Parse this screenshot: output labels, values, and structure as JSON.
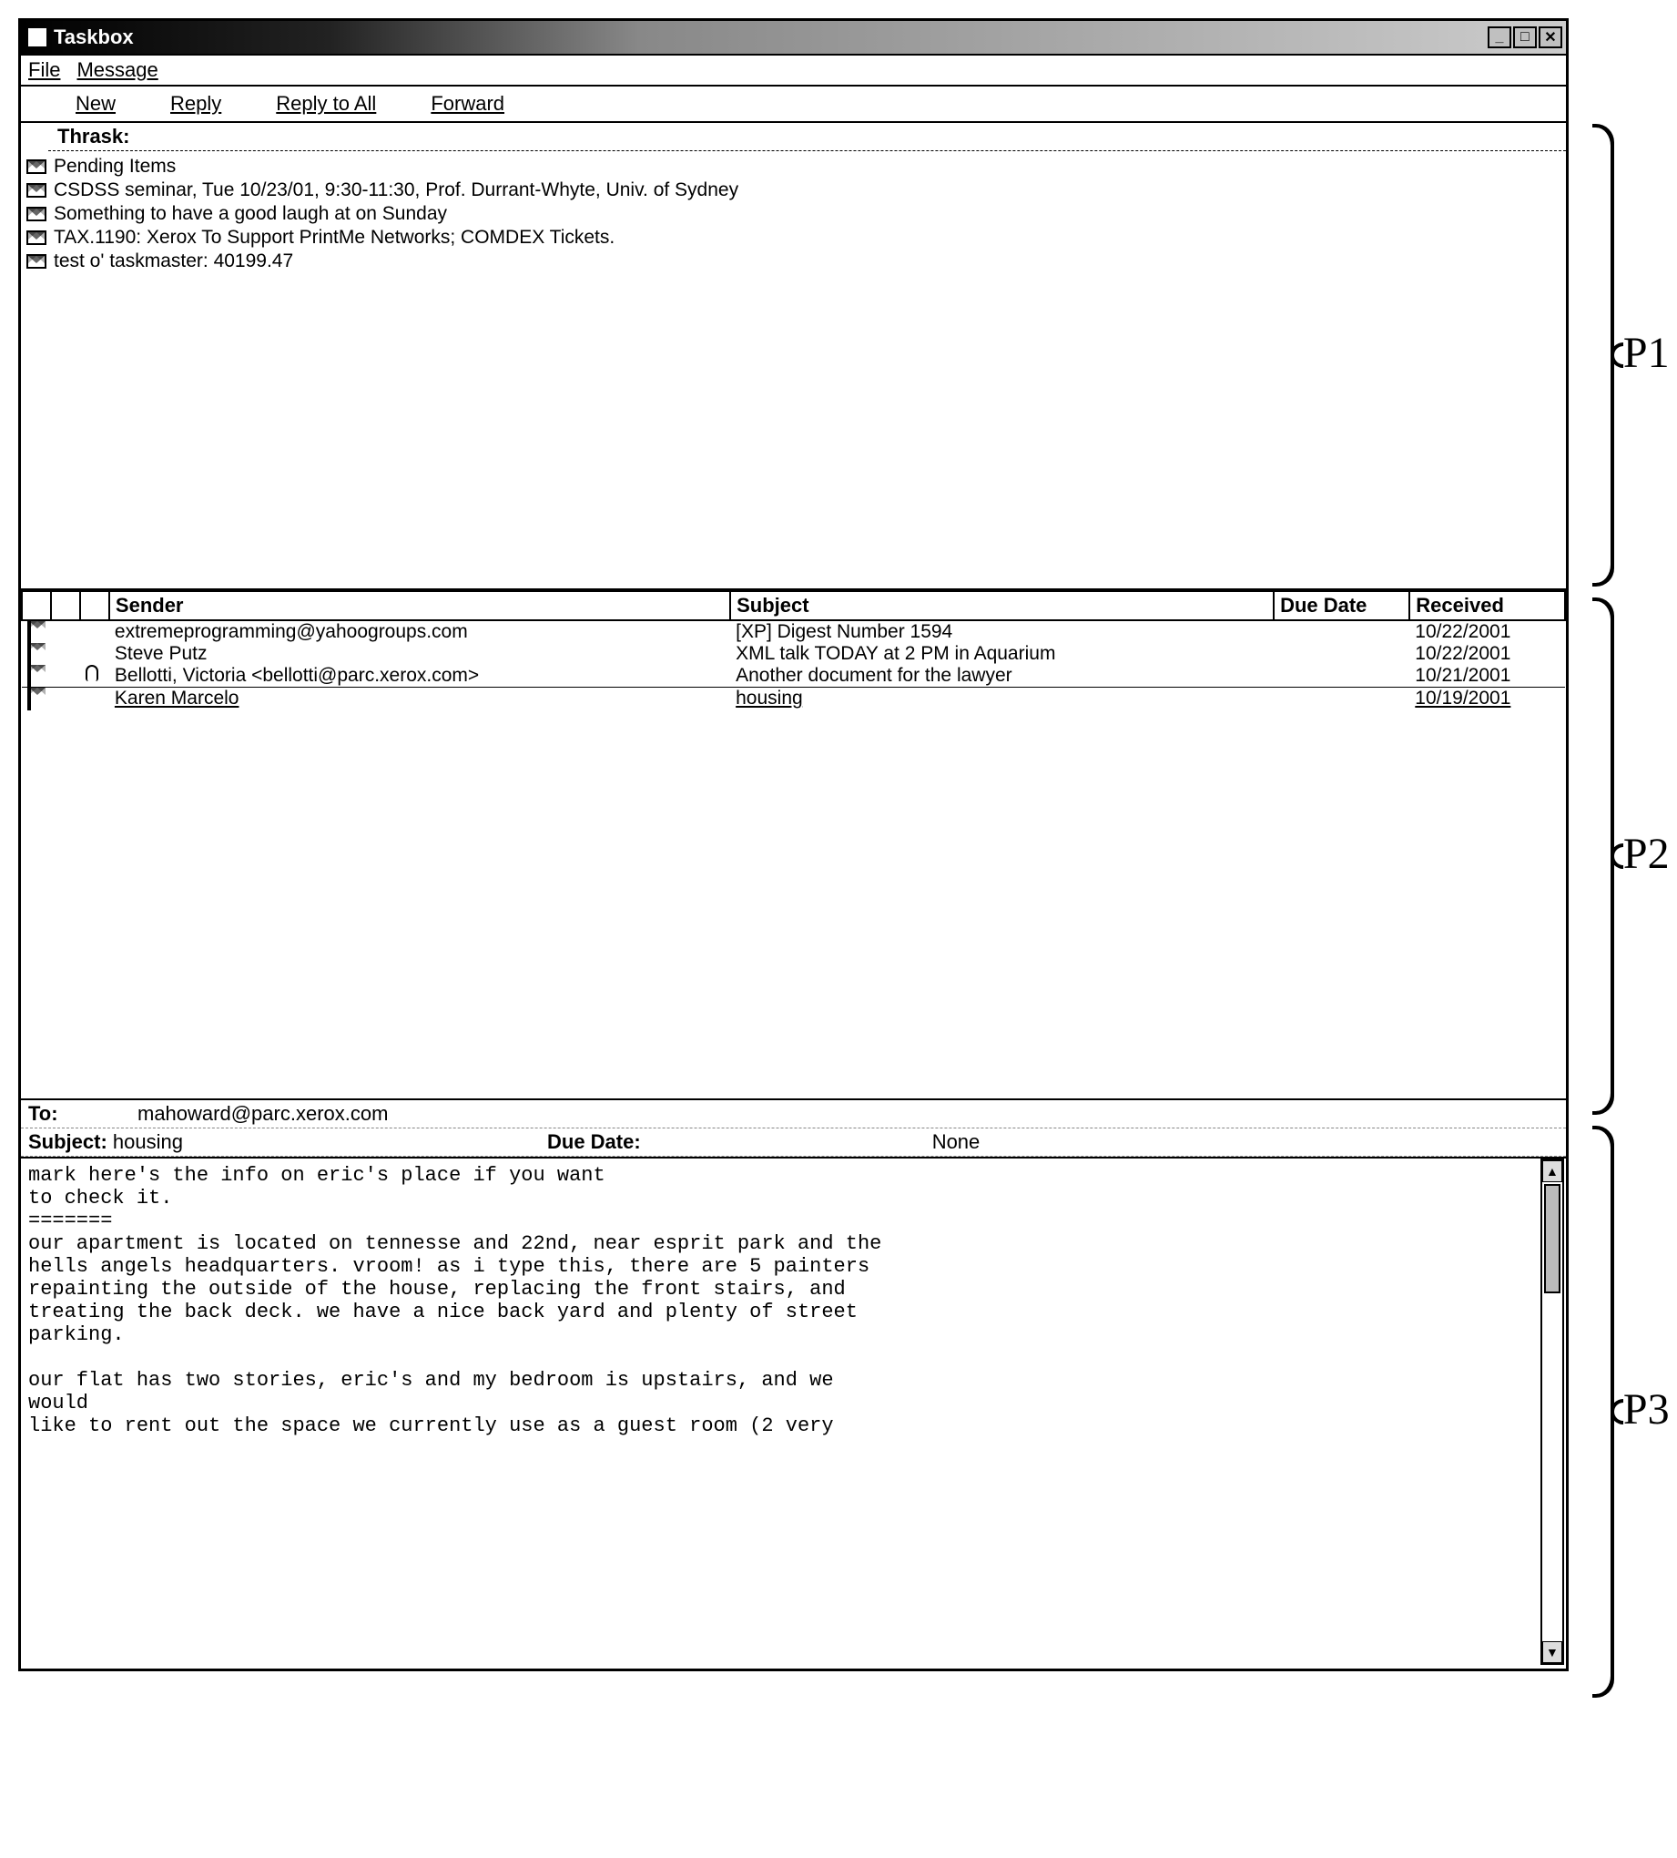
{
  "window": {
    "title": "Taskbox"
  },
  "menubar": {
    "file": "File",
    "message": "Message"
  },
  "toolbar": {
    "new": "New",
    "reply": "Reply",
    "reply_all": "Reply to All",
    "forward": "Forward"
  },
  "p1": {
    "header": "Thrask:",
    "items": [
      "Pending Items",
      "CSDSS seminar, Tue 10/23/01, 9:30-11:30, Prof. Durrant-Whyte, Univ. of Sydney",
      "Something to have a good laugh at on Sunday",
      "TAX.1190: Xerox To Support PrintMe Networks; COMDEX Tickets.",
      "test o' taskmaster: 40199.47"
    ]
  },
  "p2": {
    "columns": {
      "sender": "Sender",
      "subject": "Subject",
      "due": "Due Date",
      "received": "Received"
    },
    "rows": [
      {
        "sender": "extremeprogramming@yahoogroups.com",
        "subject": "[XP] Digest Number 1594",
        "due": "",
        "received": "10/22/2001",
        "attach": false,
        "selected": false
      },
      {
        "sender": "Steve Putz",
        "subject": "XML talk TODAY at 2 PM in Aquarium",
        "due": "",
        "received": "10/22/2001",
        "attach": false,
        "selected": false
      },
      {
        "sender": "Bellotti, Victoria <bellotti@parc.xerox.com>",
        "subject": "Another document for the lawyer",
        "due": "",
        "received": "10/21/2001",
        "attach": true,
        "selected": false
      },
      {
        "sender": "Karen Marcelo",
        "subject": "housing",
        "due": "",
        "received": "10/19/2001",
        "attach": false,
        "selected": true
      }
    ]
  },
  "p3": {
    "to_label": "To:",
    "to_value": "mahoward@parc.xerox.com",
    "subject_label": "Subject:",
    "subject_value": "housing",
    "due_label": "Due Date:",
    "due_value": "None",
    "body": "mark here's the info on eric's place if you want\nto check it.\n=======\nour apartment is located on tennesse and 22nd, near esprit park and the\nhells angels headquarters. vroom! as i type this, there are 5 painters\nrepainting the outside of the house, replacing the front stairs, and\ntreating the back deck. we have a nice back yard and plenty of street\nparking.\n\nour flat has two stories, eric's and my bedroom is upstairs, and we\nwould\nlike to rent out the space we currently use as a guest room (2 very"
  },
  "side": {
    "p1": "P1",
    "p2": "P2",
    "p3": "P3"
  }
}
